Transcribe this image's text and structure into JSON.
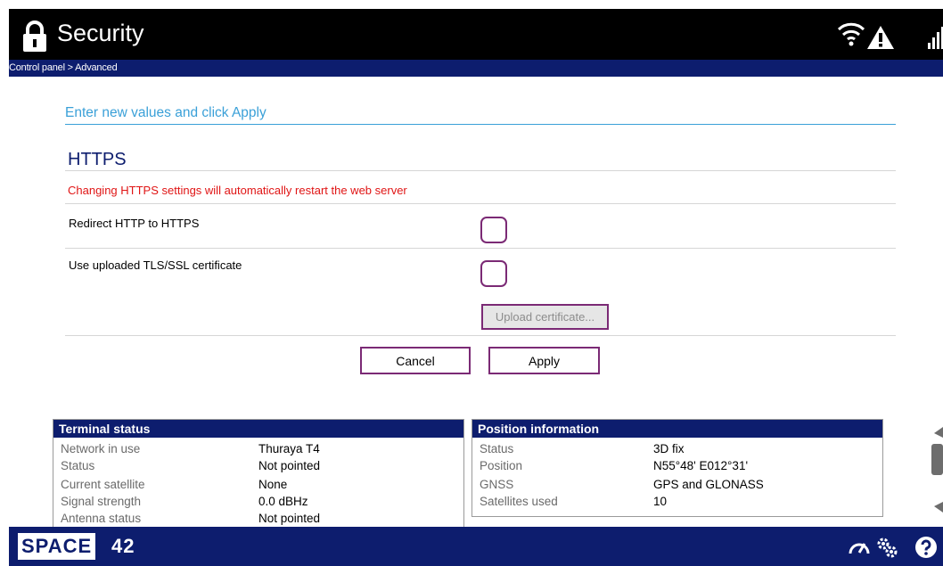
{
  "header": {
    "title": "Security",
    "breadcrumb": "Control panel > Advanced"
  },
  "form": {
    "instruction": "Enter new values and click Apply",
    "section_title": "HTTPS",
    "warning": "Changing HTTPS settings will automatically restart the web server",
    "fields": [
      {
        "label": "Redirect HTTP to HTTPS",
        "checked": false
      },
      {
        "label": "Use uploaded TLS/SSL certificate",
        "checked": false
      }
    ],
    "upload_label": "Upload certificate...",
    "cancel_label": "Cancel",
    "apply_label": "Apply"
  },
  "terminal_status": {
    "title": "Terminal status",
    "rows": [
      {
        "key": "Network in use",
        "value": "Thuraya T4"
      },
      {
        "key": "Status",
        "value": "Not pointed"
      },
      {
        "key": "Current satellite",
        "value": "None"
      },
      {
        "key": "Signal strength",
        "value": "0.0 dBHz"
      },
      {
        "key": "Antenna status",
        "value": "Not pointed"
      }
    ]
  },
  "position_info": {
    "title": "Position information",
    "rows": [
      {
        "key": "Status",
        "value": "3D fix"
      },
      {
        "key": "Position",
        "value": "N55°48' E012°31'"
      },
      {
        "key": "GNSS",
        "value": "GPS and GLONASS"
      },
      {
        "key": "Satellites used",
        "value": "10"
      }
    ]
  },
  "footer": {
    "logo_main": "SPACE",
    "logo_num": "42"
  },
  "colors": {
    "navy": "#0d1d6e",
    "accent_blue": "#3aa0d8",
    "warning_red": "#e01515",
    "button_border": "#7b2a75"
  },
  "icons": {
    "header": [
      "lock-icon",
      "wifi-icon",
      "warning-icon",
      "signal-icon"
    ],
    "footer": [
      "dashboard-icon",
      "settings-icon",
      "help-icon"
    ]
  }
}
